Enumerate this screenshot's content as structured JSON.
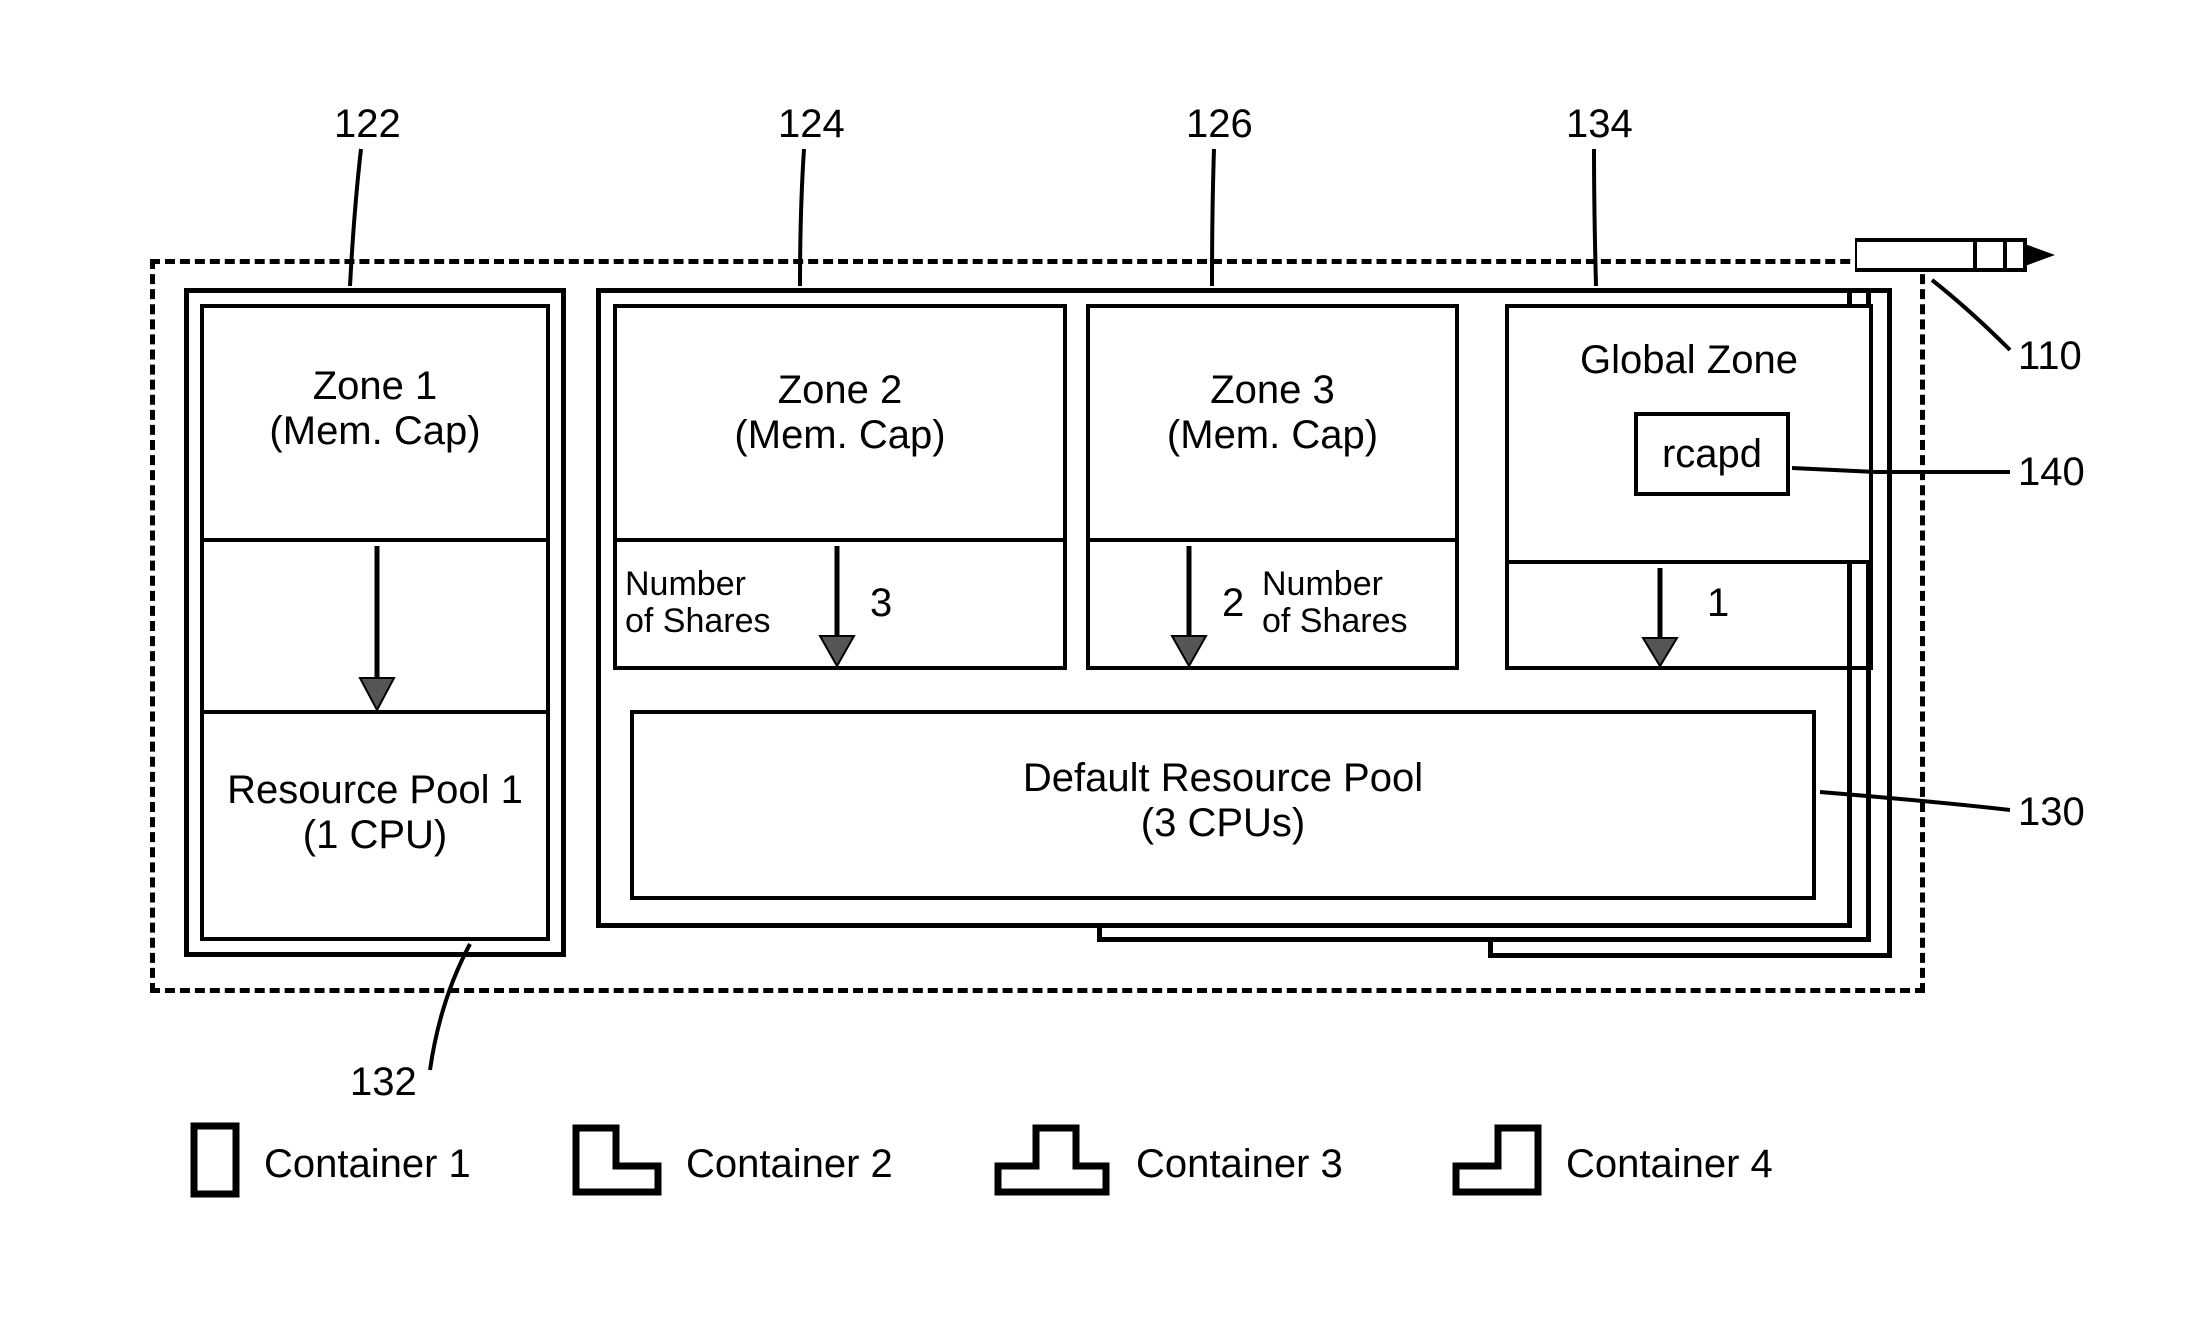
{
  "refs": {
    "r122": "122",
    "r124": "124",
    "r126": "126",
    "r134": "134",
    "r110": "110",
    "r140": "140",
    "r130": "130",
    "r132": "132"
  },
  "zone1": {
    "title": "Zone 1",
    "sub": "(Mem. Cap)"
  },
  "zone2": {
    "title": "Zone 2",
    "sub": "(Mem. Cap)"
  },
  "zone3": {
    "title": "Zone 3",
    "sub": "(Mem. Cap)"
  },
  "globalZone": {
    "title": "Global Zone",
    "daemon": "rcapd"
  },
  "pool1": {
    "title": "Resource Pool 1",
    "sub": "(1 CPU)"
  },
  "defaultPool": {
    "title": "Default Resource Pool",
    "sub": "(3 CPUs)"
  },
  "sharesLabel": {
    "line1": "Number",
    "line2": "of Shares"
  },
  "shareCounts": {
    "zone2": "3",
    "zone3": "2",
    "global": "1"
  },
  "legend": {
    "c1": "Container 1",
    "c2": "Container 2",
    "c3": "Container 3",
    "c4": "Container 4"
  }
}
